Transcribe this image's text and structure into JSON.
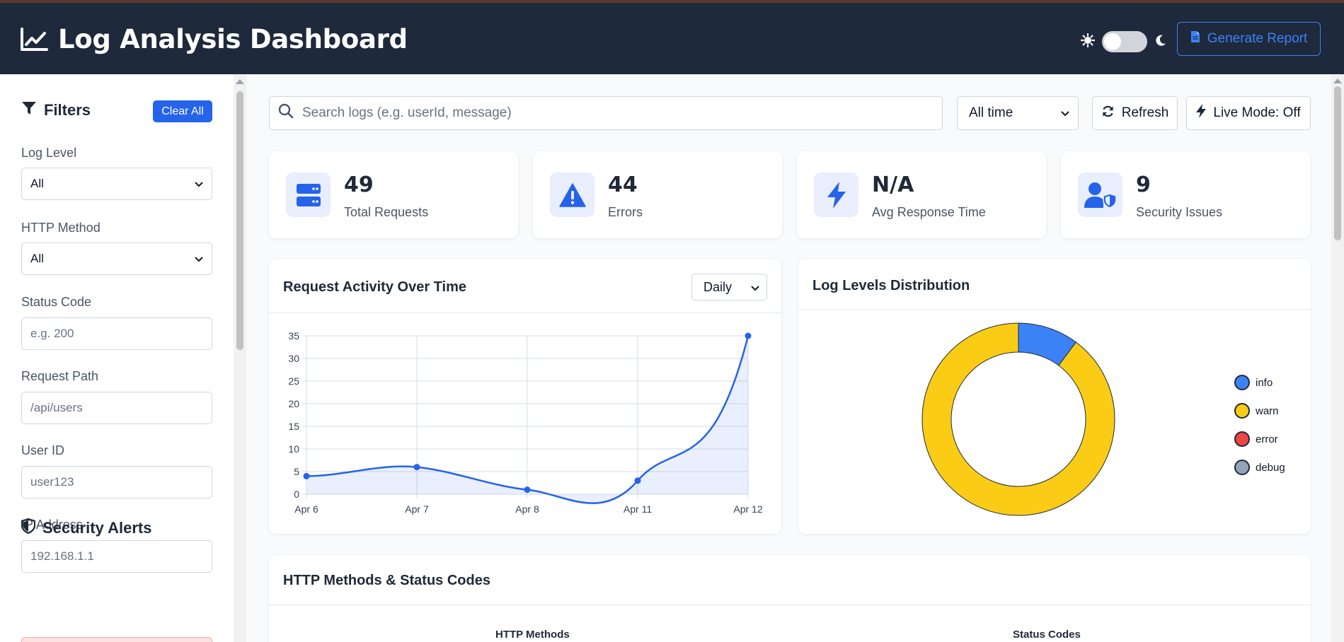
{
  "header": {
    "title": "Log Analysis Dashboard",
    "generate_report": "Generate Report"
  },
  "sidebar": {
    "filters_title": "Filters",
    "clear_all": "Clear All",
    "log_level": {
      "label": "Log Level",
      "value": "All"
    },
    "http_method": {
      "label": "HTTP Method",
      "value": "All"
    },
    "status_code": {
      "label": "Status Code",
      "placeholder": "e.g. 200"
    },
    "request_path": {
      "label": "Request Path",
      "placeholder": "/api/users"
    },
    "user_id": {
      "label": "User ID",
      "placeholder": "user123"
    },
    "ip_address": {
      "label": "IP Address",
      "placeholder": "192.168.1.1"
    },
    "security_alerts_title": "Security Alerts"
  },
  "toolbar": {
    "search_placeholder": "Search logs (e.g. userId, message)",
    "time_range": "All time",
    "refresh": "Refresh",
    "live_mode": "Live Mode: Off"
  },
  "stats": [
    {
      "value": "49",
      "label": "Total Requests",
      "icon": "server-icon"
    },
    {
      "value": "44",
      "label": "Errors",
      "icon": "warning-icon"
    },
    {
      "value": "N/A",
      "label": "Avg Response Time",
      "icon": "bolt-icon"
    },
    {
      "value": "9",
      "label": "Security Issues",
      "icon": "user-shield-icon"
    }
  ],
  "activity_panel": {
    "title": "Request Activity Over Time",
    "interval": "Daily"
  },
  "distribution_panel": {
    "title": "Log Levels Distribution"
  },
  "methods_panel": {
    "title": "HTTP Methods & Status Codes",
    "left_title": "HTTP Methods",
    "right_title": "Status Codes"
  },
  "colors": {
    "accent": "#2563eb",
    "header_bg": "#1e293b",
    "info": "#3b82f6",
    "warn": "#facc15",
    "error": "#ef4444",
    "debug": "#94a3b8"
  },
  "chart_data": [
    {
      "type": "area",
      "title": "Request Activity Over Time",
      "categories": [
        "Apr 6",
        "Apr 7",
        "Apr 8",
        "Apr 11",
        "Apr 12"
      ],
      "values": [
        4,
        6,
        1,
        3,
        35
      ],
      "ylim": [
        0,
        35
      ],
      "yticks": [
        0,
        5,
        10,
        15,
        20,
        25,
        30,
        35
      ],
      "grid": true,
      "color": "#2563eb"
    },
    {
      "type": "pie",
      "title": "Log Levels Distribution",
      "categories": [
        "info",
        "warn",
        "error",
        "debug"
      ],
      "values": [
        5,
        44,
        0,
        0
      ],
      "colors": [
        "#3b82f6",
        "#facc15",
        "#ef4444",
        "#94a3b8"
      ],
      "legend": "right"
    }
  ]
}
